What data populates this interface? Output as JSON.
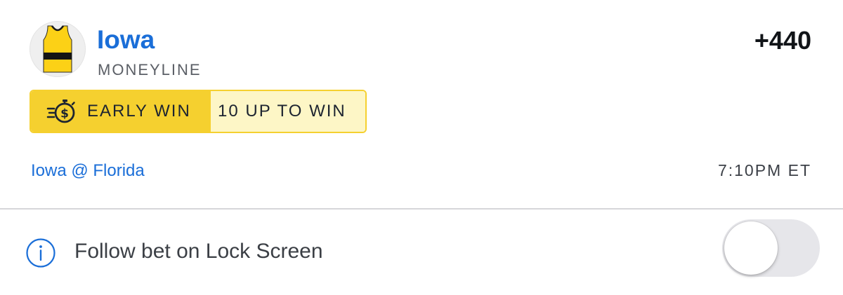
{
  "bet": {
    "team": "Iowa",
    "jersey_icon": "jersey-icon",
    "jersey_colors": {
      "primary": "#fcd116",
      "stripe": "#111111"
    },
    "odds": "+440",
    "type": "MONEYLINE"
  },
  "promo": {
    "icon": "stopwatch-dollar-icon",
    "label": "EARLY WIN",
    "detail": "10 UP TO WIN",
    "colors": {
      "accent": "#f5d02f",
      "light": "#fdf6c6"
    }
  },
  "game": {
    "matchup": "Iowa @ Florida",
    "time": "7:10PM ET"
  },
  "follow": {
    "icon": "info-icon",
    "label": "Follow bet on Lock Screen",
    "enabled": false
  },
  "colors": {
    "link": "#1a6ed8",
    "text": "#111418",
    "muted": "#5b5f66"
  }
}
